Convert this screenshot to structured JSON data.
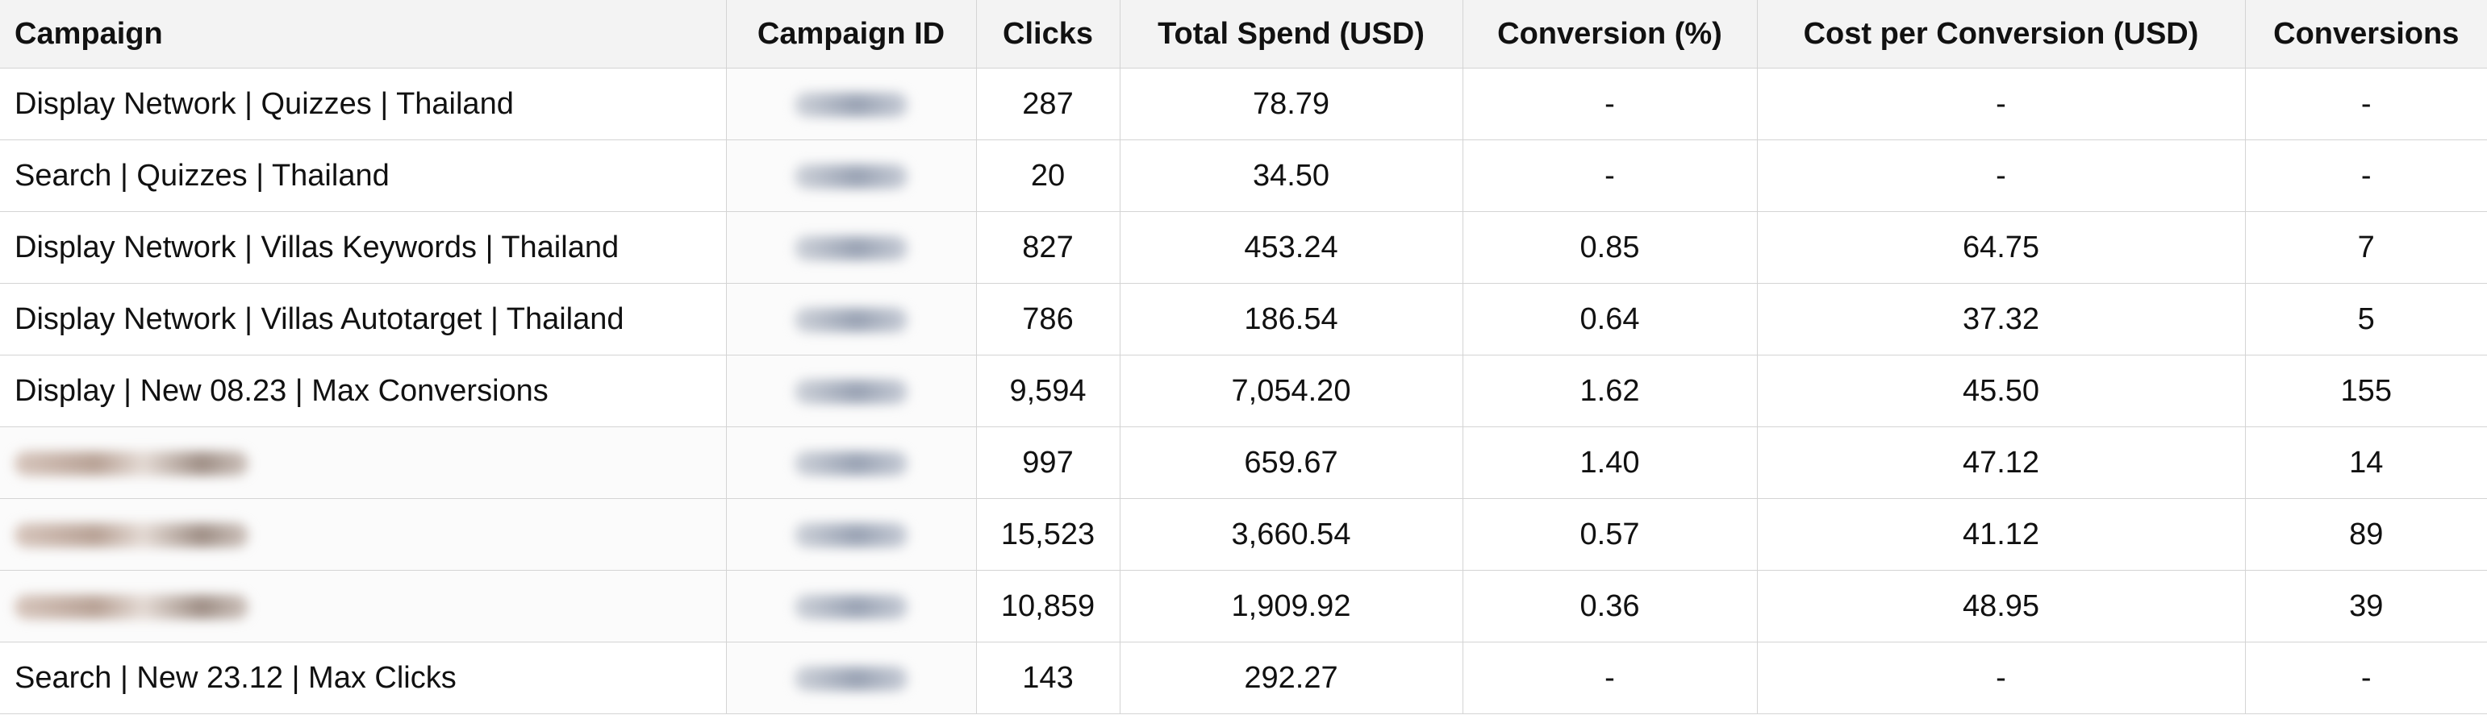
{
  "table": {
    "headers": [
      "Campaign",
      "Campaign ID",
      "Clicks",
      "Total Spend (USD)",
      "Conversion (%)",
      "Cost per Conversion (USD)",
      "Conversions"
    ],
    "rows": [
      {
        "campaign": "Display Network | Quizzes | Thailand",
        "clicks": "287",
        "spend": "78.79",
        "conv_pct": "-",
        "cost_per_conv": "-",
        "conversions": "-"
      },
      {
        "campaign": "Search | Quizzes | Thailand",
        "clicks": "20",
        "spend": "34.50",
        "conv_pct": "-",
        "cost_per_conv": "-",
        "conversions": "-"
      },
      {
        "campaign": "Display Network | Villas Keywords | Thailand",
        "clicks": "827",
        "spend": "453.24",
        "conv_pct": "0.85",
        "cost_per_conv": "64.75",
        "conversions": "7"
      },
      {
        "campaign": "Display Network | Villas Autotarget | Thailand",
        "clicks": "786",
        "spend": "186.54",
        "conv_pct": "0.64",
        "cost_per_conv": "37.32",
        "conversions": "5"
      },
      {
        "campaign": "Display | New 08.23 | Max Conversions",
        "clicks": "9,594",
        "spend": "7,054.20",
        "conv_pct": "1.62",
        "cost_per_conv": "45.50",
        "conversions": "155"
      },
      {
        "campaign": "",
        "clicks": "997",
        "spend": "659.67",
        "conv_pct": "1.40",
        "cost_per_conv": "47.12",
        "conversions": "14"
      },
      {
        "campaign": "",
        "clicks": "15,523",
        "spend": "3,660.54",
        "conv_pct": "0.57",
        "cost_per_conv": "41.12",
        "conversions": "89"
      },
      {
        "campaign": "",
        "clicks": "10,859",
        "spend": "1,909.92",
        "conv_pct": "0.36",
        "cost_per_conv": "48.95",
        "conversions": "39"
      },
      {
        "campaign": "Search | New 23.12 | Max Clicks",
        "clicks": "143",
        "spend": "292.27",
        "conv_pct": "-",
        "cost_per_conv": "-",
        "conversions": "-"
      }
    ]
  }
}
